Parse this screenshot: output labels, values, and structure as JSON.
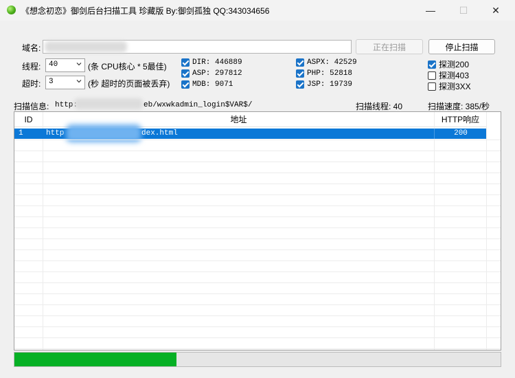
{
  "window": {
    "title": "《想念初恋》御剑后台扫描工具 珍藏版 By:御剑孤独 QQ:343034656",
    "minimize": "—",
    "maximize": "☐",
    "close": "✕"
  },
  "form": {
    "domain_label": "域名:",
    "domain_value": "",
    "scanning_button": "正在扫描",
    "stop_button": "停止扫描",
    "threads_label": "线程:",
    "threads_value": "40",
    "threads_hint": "(条 CPU核心 * 5最佳)",
    "timeout_label": "超时:",
    "timeout_value": "3",
    "timeout_hint": "(秒 超时的页面被丢弃)"
  },
  "dicts": [
    {
      "label": "DIR: 446889",
      "checked": true
    },
    {
      "label": "ASP: 297812",
      "checked": true
    },
    {
      "label": "MDB: 9071",
      "checked": true
    },
    {
      "label": "ASPX: 42529",
      "checked": true
    },
    {
      "label": "PHP: 52818",
      "checked": true
    },
    {
      "label": "JSP: 19739",
      "checked": true
    }
  ],
  "probes": [
    {
      "label": "探测200",
      "checked": true
    },
    {
      "label": "探测403",
      "checked": false
    },
    {
      "label": "探测3XX",
      "checked": false
    }
  ],
  "status": {
    "info_label": "扫描信息:",
    "info_prefix": "http:",
    "info_suffix": "eb/wxwkadmin_login$VAR$/",
    "threads_text": "扫描线程: 40",
    "speed_text": "扫描速度: 385/秒"
  },
  "table": {
    "columns": [
      "ID",
      "地址",
      "HTTP响应"
    ],
    "rows": [
      {
        "id": "1",
        "url_prefix": "http",
        "url_suffix": "dex.html",
        "code": "200",
        "selected": true
      }
    ]
  },
  "progress": {
    "value": 0.333
  },
  "colors": {
    "selection": "#0b78d7",
    "progress": "#06b025",
    "check": "#1a73c8"
  }
}
